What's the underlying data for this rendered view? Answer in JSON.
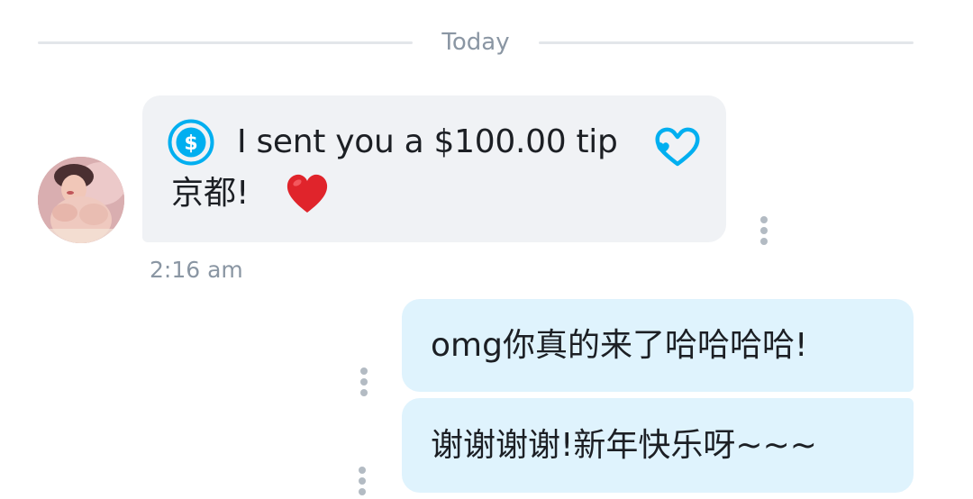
{
  "divider": {
    "label": "Today"
  },
  "messages": {
    "incoming_tip": {
      "tip_label": "I sent you a $100.00 tip",
      "text": "京都!",
      "time": "2:16 am",
      "icons": {
        "tip": "dollar-circle-icon",
        "tip_heart": "heart-outline-icon",
        "emoji": "red-heart-emoji"
      }
    },
    "outgoing": [
      {
        "text": "omg你真的来了哈哈哈哈!"
      },
      {
        "text": "谢谢谢谢!新年快乐呀~~~"
      }
    ]
  },
  "colors": {
    "incoming_bubble": "#f0f2f5",
    "outgoing_bubble": "#dff3fd",
    "accent": "#00aff0",
    "muted_text": "#8a96a3",
    "heart": "#e0242b"
  }
}
